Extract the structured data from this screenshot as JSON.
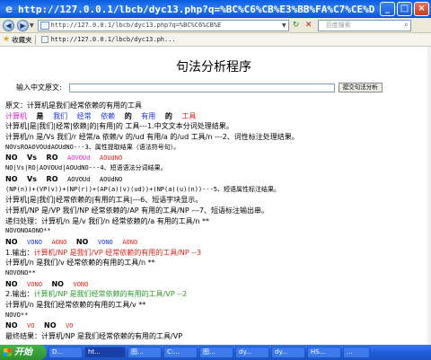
{
  "window": {
    "title": "http://127.0.0.1/lbcb/dyc13.php?q=%BC%C6%CB%E3%BB%FA%C7%CE%D...",
    "minimize": "_",
    "maximize": "□",
    "close": "×"
  },
  "nav": {
    "address": "http://127.0.0.1/lbcb/dyc13.php?q=%BC%C6%CB%E",
    "search_placeholder": "百度搜索"
  },
  "favorites": {
    "label": "收藏夹",
    "tab_title": "http://127.0.0.1/lbcb/dyc13.ph..."
  },
  "page": {
    "heading": "句法分析程序",
    "input_label": "输入中文原文:",
    "submit_label": "提交句法分析",
    "lines": {
      "l1": "原文：计算机是我们经常依赖的有用的工具",
      "l2": [
        "计算机",
        "是",
        "我们",
        "经常",
        "依赖",
        "的",
        "有用",
        "的",
        "工具"
      ],
      "l3": " 计算机|是|我们|经常|依赖|的|有用|的 工具---1.中文文本分词处理结果。",
      "l4": "计算机/n 是/Vs 我们/r 经常/a 依赖/v 的/ud 有用/a 的/ud 工具/n ---2、词性标注处理结果。",
      "l5": "NOVsROAOVOUdAOUdNO---3、属性提取结果（语法符号句）。",
      "l6": [
        "NO",
        "Vs",
        "RO",
        "AOVOUd",
        "AOUdNO"
      ],
      "l7": "NO|Vs|RO|AOVOUd|AOUdNO---4、短语语法分词结果。",
      "l8": [
        "NO",
        "Vs",
        "RO",
        "AOVOUd",
        "AOUdNO"
      ],
      "l9": "(NP(n))+(VP(v))+(NP(r))+(AP(a)(v)(ud))+(NP(a)(u)(n))---5、短语属性标注结果。",
      "l10": "计算机|是|我们|经常依赖的|有用的工具|---6、短语字块显示。",
      "l11": "计算机/NP 是/VP 我们/NP 经常依赖的/AP 有用的工具/NP ---7、短语标注输出串。",
      "l12": "递归处理：计算机/n 是/v 我们/n 经常依赖的/a 有用的工具/n **",
      "l13": "NOVONOAONO**",
      "l14": [
        "NO",
        "VONO",
        "AONO",
        "NO",
        "VONO",
        "AONO"
      ],
      "l15_prefix": "1.输出：",
      "l15_colored": "计算机/NP 是我们/VP 经常依赖的有用的工具/NP --3",
      "l16": "计算机/n 是我们/v 经常依赖的有用的工具/n **",
      "l17": "NOVONO**",
      "l18": [
        "NO",
        "VONO",
        "NO",
        "VONO"
      ],
      "l19_prefix": "2.输出：",
      "l19_colored": "计算机/NP 是我们经常依赖的有用的工具/VP --2",
      "l20": "计算机/n 是我们经常依赖的有用的工具/v **",
      "l21": "NOVO**",
      "l22": [
        "NO",
        "VO",
        "NO",
        "VO"
      ],
      "l23": "最终结果：计算机/NP 是我们经常依赖的有用的工具/VP"
    }
  },
  "taskbar": {
    "start": "开始",
    "items": [
      "D...",
      "ht...",
      "图...",
      "C:...",
      "图...",
      "dy...",
      "dy...",
      "HS...",
      "..."
    ]
  },
  "colors": {
    "pink": "#e01cc0",
    "blue": "#1c2fe0",
    "red": "#e0201c",
    "green": "#2a9a2a"
  }
}
